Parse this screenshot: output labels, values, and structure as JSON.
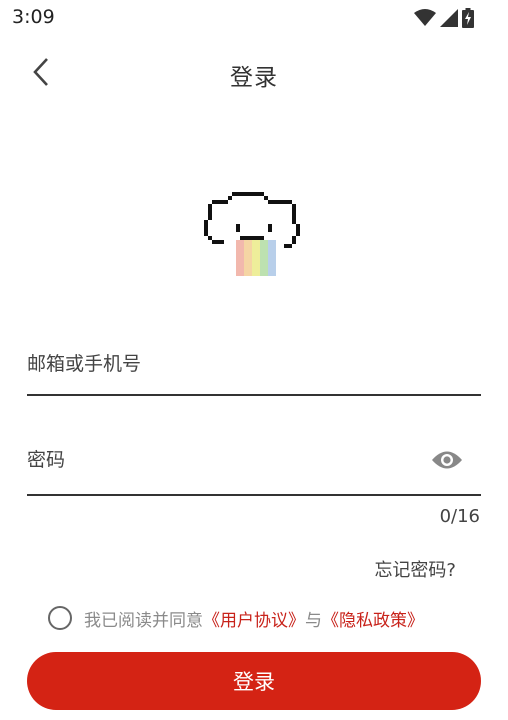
{
  "status_bar": {
    "time": "3:09"
  },
  "header": {
    "title": "登录"
  },
  "form": {
    "email_placeholder": "邮箱或手机号",
    "password_placeholder": "密码",
    "password_counter": "0/16"
  },
  "forgot_password_label": "忘记密码?",
  "agreement": {
    "prefix": "我已阅读并同意",
    "user_agreement": "《用户协议》",
    "joiner": "与",
    "privacy_policy": "《隐私政策》"
  },
  "login_button_label": "登录",
  "colors": {
    "primary": "#d42314",
    "link": "#c8221a"
  },
  "icons": [
    "wifi-icon",
    "cellular-signal-icon",
    "battery-charging-icon",
    "back-arrow-icon",
    "pixel-cloud-logo",
    "eye-icon"
  ]
}
